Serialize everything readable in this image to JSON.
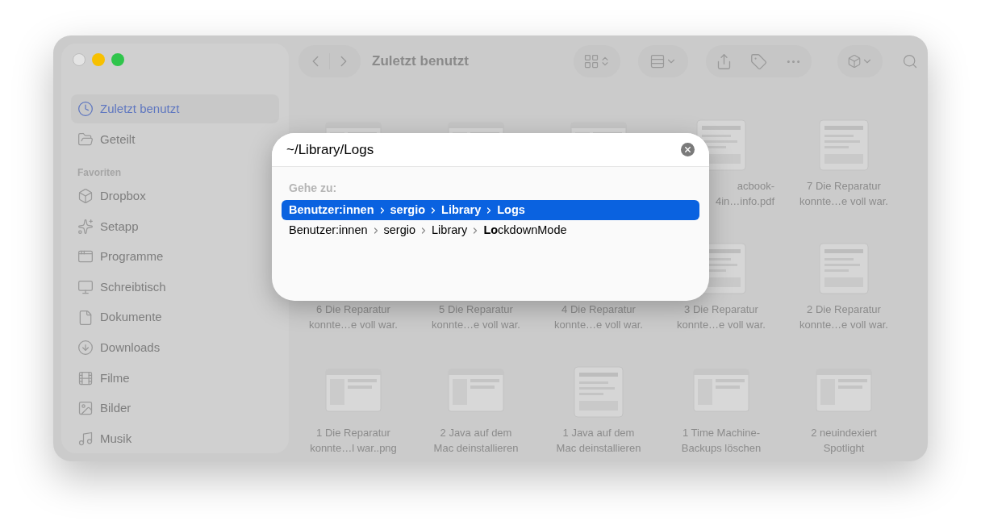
{
  "window": {
    "title": "Zuletzt benutzt"
  },
  "sidebar": {
    "items": [
      {
        "label": "Zuletzt benutzt",
        "selected": true
      },
      {
        "label": "Geteilt",
        "selected": false
      }
    ],
    "section": "Favoriten",
    "favorites": [
      {
        "label": "Dropbox",
        "selected": false
      },
      {
        "label": "Setapp",
        "selected": false
      },
      {
        "label": "Programme",
        "selected": false
      },
      {
        "label": "Schreibtisch",
        "selected": false
      },
      {
        "label": "Dokumente",
        "selected": false
      },
      {
        "label": "Downloads",
        "selected": false
      },
      {
        "label": "Filme",
        "selected": false
      },
      {
        "label": "Bilder",
        "selected": false
      },
      {
        "label": "Musik",
        "selected": false
      }
    ]
  },
  "files": [
    [
      {
        "kind": "screenshot"
      },
      {
        "kind": "screenshot"
      },
      {
        "kind": "screenshot"
      },
      {
        "kind": "document",
        "lines": [
          "acbook-",
          "4in…info.pdf"
        ]
      },
      {
        "kind": "document",
        "lines": [
          "7 Die Reparatur",
          "konnte…e voll war."
        ]
      }
    ],
    [
      {
        "lines": [
          "6 Die Reparatur",
          "konnte…e voll war."
        ]
      },
      {
        "lines": [
          "5 Die Reparatur",
          "konnte…e voll war."
        ]
      },
      {
        "lines": [
          "4 Die Reparatur",
          "konnte…e voll war."
        ]
      },
      {
        "kind": "document",
        "lines": [
          "3 Die Reparatur",
          "konnte…e voll war."
        ]
      },
      {
        "kind": "document",
        "lines": [
          "2 Die Reparatur",
          "konnte…e voll war."
        ]
      }
    ],
    [
      {
        "kind": "screenshot",
        "lines": [
          "1 Die Reparatur",
          "konnte…l war..png"
        ]
      },
      {
        "kind": "screenshot",
        "lines": [
          "2 Java auf dem",
          "Mac deinstallieren"
        ]
      },
      {
        "kind": "document",
        "lines": [
          "1 Java auf dem",
          "Mac deinstallieren"
        ]
      },
      {
        "kind": "screenshot",
        "lines": [
          "1 Time Machine-",
          "Backups löschen"
        ]
      },
      {
        "kind": "screenshot",
        "lines": [
          "2 neuindexiert",
          "Spotlight"
        ]
      }
    ]
  ],
  "goto": {
    "value": "~/Library/Logs",
    "heading": "Gehe zu:",
    "results": [
      {
        "selected": true,
        "segments": [
          "Benutzer:innen",
          "sergio",
          "Library",
          "**Logs**"
        ]
      },
      {
        "selected": false,
        "segments": [
          "Benutzer:innen",
          "sergio",
          "Library",
          "**Lo**ckdownMode"
        ]
      }
    ]
  }
}
